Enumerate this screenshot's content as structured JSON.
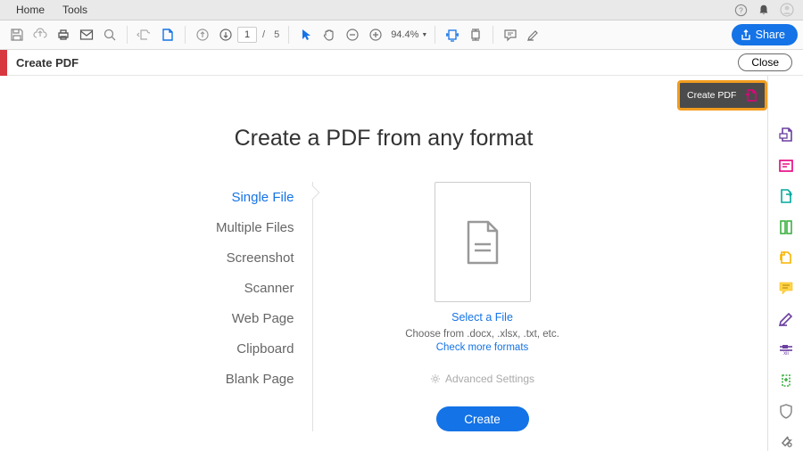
{
  "menubar": {
    "home": "Home",
    "tools": "Tools"
  },
  "toolbar": {
    "page_current": "1",
    "page_sep": "/",
    "page_total": "5",
    "zoom": "94.4%",
    "share": "Share"
  },
  "subbar": {
    "title": "Create PDF",
    "close": "Close"
  },
  "callout": {
    "label": "Create PDF"
  },
  "main": {
    "heading": "Create a PDF from any format",
    "options": [
      "Single File",
      "Multiple Files",
      "Screenshot",
      "Scanner",
      "Web Page",
      "Clipboard",
      "Blank Page"
    ],
    "select_file": "Select a File",
    "choose": "Choose from .docx, .xlsx, .txt, etc.",
    "check_more": "Check more formats",
    "advanced": "Advanced Settings",
    "create": "Create"
  },
  "colors": {
    "blue": "#1473e6",
    "pink": "#e6007e",
    "green": "#3cb043",
    "yellow": "#f7b500",
    "purple": "#6b3fa0",
    "teal": "#00a99d"
  }
}
